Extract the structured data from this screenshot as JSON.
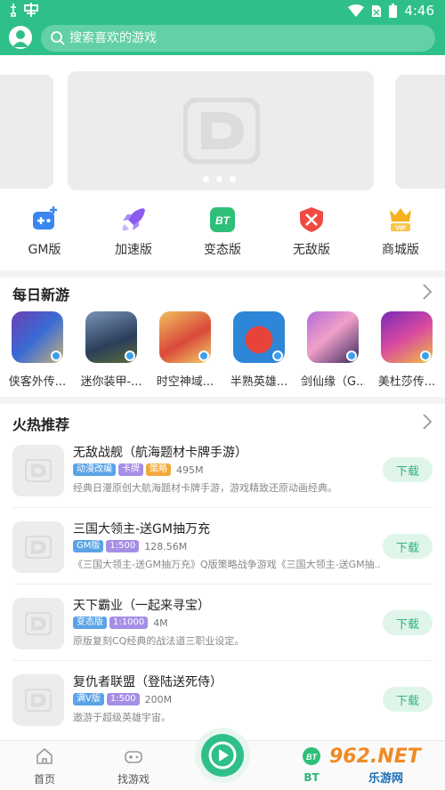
{
  "status_bar": {
    "time": "4:46"
  },
  "search": {
    "placeholder": "搜索喜欢的游戏"
  },
  "categories": [
    {
      "label": "GM版",
      "icon": "gamepad-icon"
    },
    {
      "label": "加速版",
      "icon": "rocket-icon"
    },
    {
      "label": "变态版",
      "icon": "bt-icon",
      "icon_text": "BT"
    },
    {
      "label": "无敌版",
      "icon": "shield-icon"
    },
    {
      "label": "商城版",
      "icon": "vip-crown-icon",
      "icon_text": "VIP"
    }
  ],
  "daily_new": {
    "title": "每日新游",
    "games": [
      {
        "name": "侠客外传..."
      },
      {
        "name": "迷你装甲-..."
      },
      {
        "name": "时空神域..."
      },
      {
        "name": "半熟英雄..."
      },
      {
        "name": "剑仙缘（G..."
      },
      {
        "name": "美杜莎传..."
      }
    ]
  },
  "hot": {
    "title": "火热推荐",
    "download_label": "下载",
    "items": [
      {
        "title": "无敌战舰（航海题材卡牌手游）",
        "tags": [
          "动漫改编",
          "卡牌",
          "策略"
        ],
        "size": "495M",
        "desc": "经典日漫原创大航海题材卡牌手游，游戏精致还原动画经典。"
      },
      {
        "title": "三国大领主-送GM抽万充",
        "tags": [
          "GM版",
          "1:500"
        ],
        "size": "128.56M",
        "desc": "《三国大领主-送GM抽万充》Q版策略战争游戏《三国大领主-送GM抽..."
      },
      {
        "title": "天下霸业（一起来寻宝）",
        "tags": [
          "变态版",
          "1:1000"
        ],
        "size": "4M",
        "desc": "原版复刻CQ经典的战法道三职业设定。"
      },
      {
        "title": "复仇者联盟（登陆送死侍）",
        "tags": [
          "满V版",
          "1:500"
        ],
        "size": "200M",
        "desc": "遨游于超级英雄宇宙。"
      }
    ]
  },
  "bottom_nav": {
    "home": "首页",
    "find": "找游戏",
    "bt": "BT",
    "bt_icon_text": "BT"
  },
  "watermark": {
    "logo": "962.NET",
    "sub": "乐游网"
  },
  "colors": {
    "brand": "#2fc08a",
    "download_bg": "#dff5ea",
    "download_text": "#2fb47c"
  }
}
